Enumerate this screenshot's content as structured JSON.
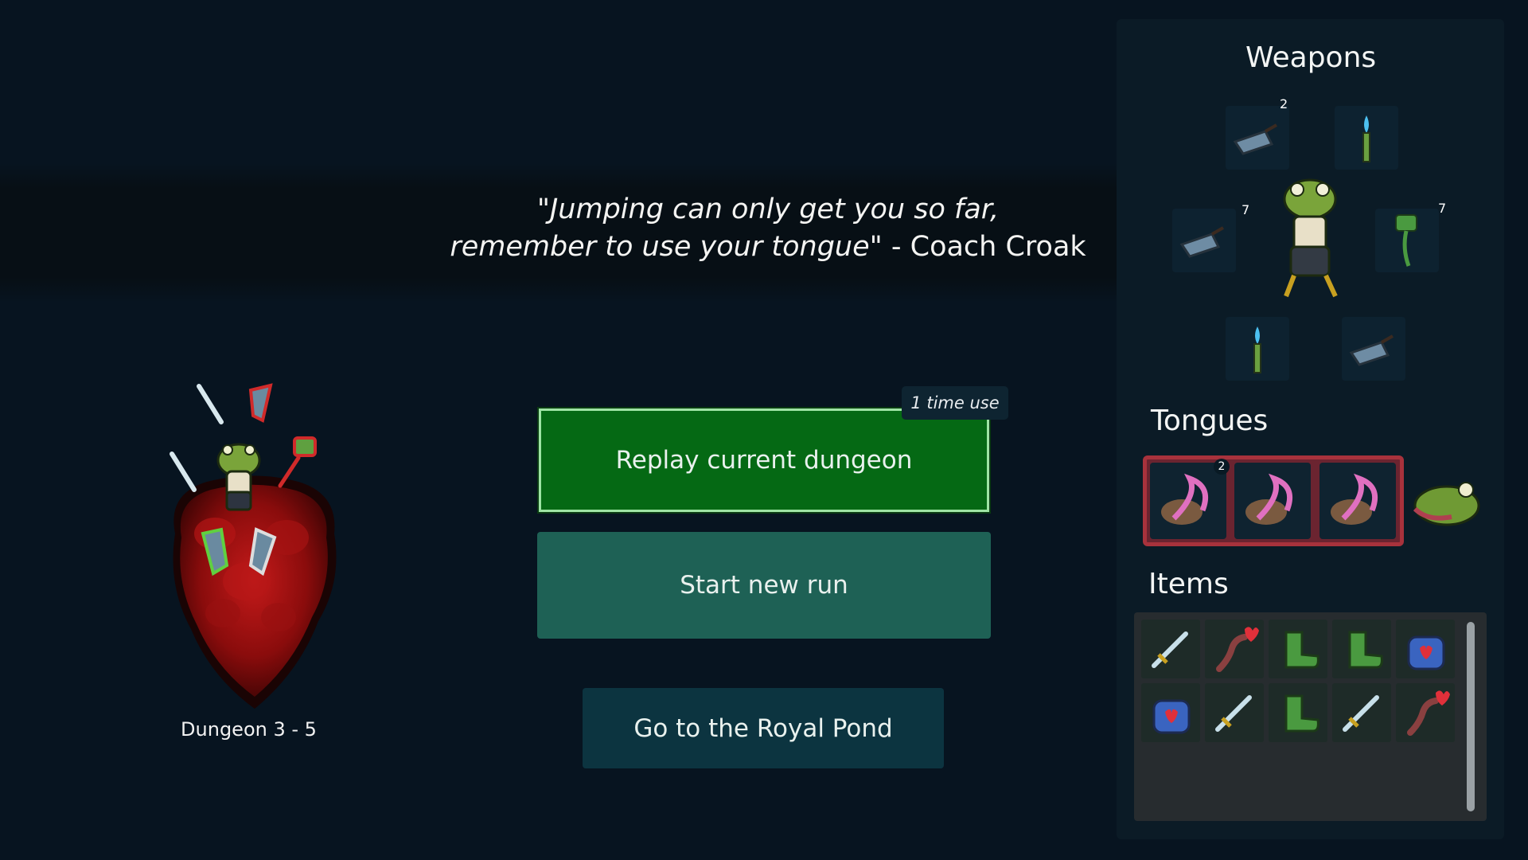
{
  "quote": {
    "line1": "\"Jumping can only get you so far,",
    "line2_quote": "remember to use your tongue\"",
    "attribution": " - Coach Croak"
  },
  "dungeon": {
    "label": "Dungeon 3 - 5"
  },
  "actions": {
    "replay_label": "Replay current dungeon",
    "replay_badge": "1 time use",
    "new_run_label": "Start new run",
    "pond_label": "Go to the Royal Pond"
  },
  "panel": {
    "weapons_title": "Weapons",
    "tongues_title": "Tongues",
    "items_title": "Items"
  },
  "weapons": [
    {
      "icon": "blue-glove-icon",
      "count": "2"
    },
    {
      "icon": "blue-flame-torch-icon",
      "count": ""
    },
    {
      "icon": "blue-glove-icon",
      "count": "7"
    },
    {
      "icon": "fly-swatter-icon",
      "count": "7"
    },
    {
      "icon": "blue-flame-torch-icon",
      "count": ""
    },
    {
      "icon": "blue-glove-icon",
      "count": ""
    }
  ],
  "tongues": [
    {
      "icon": "tongue-frog-icon",
      "count": "2"
    },
    {
      "icon": "tongue-frog-icon",
      "count": ""
    },
    {
      "icon": "tongue-frog-icon",
      "count": ""
    }
  ],
  "items": [
    "sword-icon",
    "worm-heart-icon",
    "green-boot-icon",
    "green-boot-icon",
    "heart-jar-icon",
    "heart-jar-icon",
    "sword-icon",
    "green-boot-icon",
    "sword-icon",
    "worm-heart-icon"
  ],
  "colors": {
    "background": "#071420",
    "replay_button": "#056914",
    "new_run_button": "#1e6155",
    "pond_button": "#0c3440",
    "tongue_frame": "#a8323c"
  }
}
